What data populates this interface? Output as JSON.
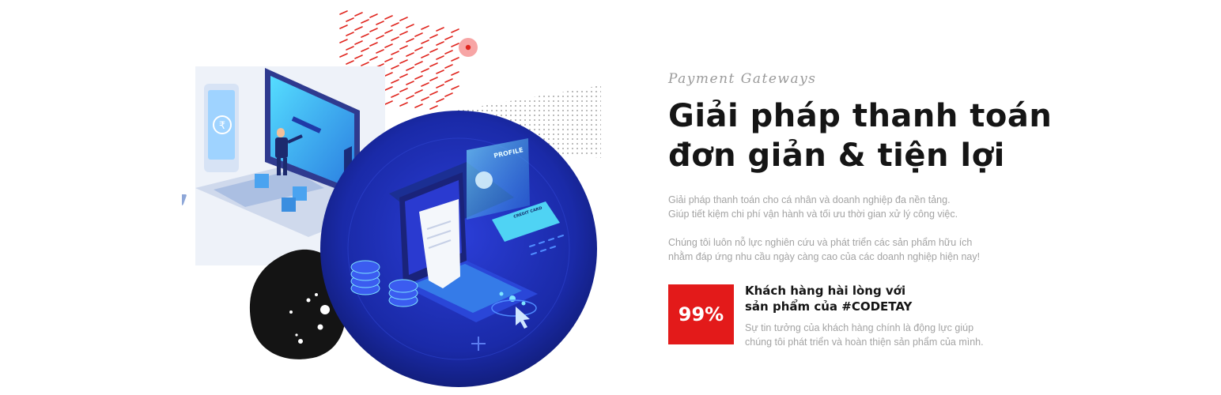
{
  "section": {
    "eyebrow": "Payment Gateways",
    "title_line1": "Giải pháp thanh toán",
    "title_line2": "đơn giản & tiện lợi",
    "para1_line1": "Giải pháp thanh toán cho cá nhân và doanh nghiệp đa nền tảng.",
    "para1_line2": "Giúp tiết kiệm chi phí vận hành và tối ưu thời gian xử lý công việc.",
    "para2_line1": "Chúng tôi luôn nỗ lực nghiên cứu và phát triển các sản phẩm hữu ích",
    "para2_line2": "nhằm đáp ứng nhu cầu ngày càng cao của các doanh nghiệp hiện nay!"
  },
  "stat": {
    "value": "99%",
    "title_line1": "Khách hàng hài lòng với",
    "title_line2": "sản phẩm của #CODETAY",
    "desc_line1": "Sự tin tưởng của khách hàng chính là động lực giúp",
    "desc_line2": "chúng tôi phát triển và hoàn thiện sản phẩm của mình.",
    "badge_color": "#e31a1a"
  },
  "illustration": {
    "screen_label": "PROFILE",
    "card_label": "CREDIT CARD",
    "currency_symbol": "₹"
  }
}
